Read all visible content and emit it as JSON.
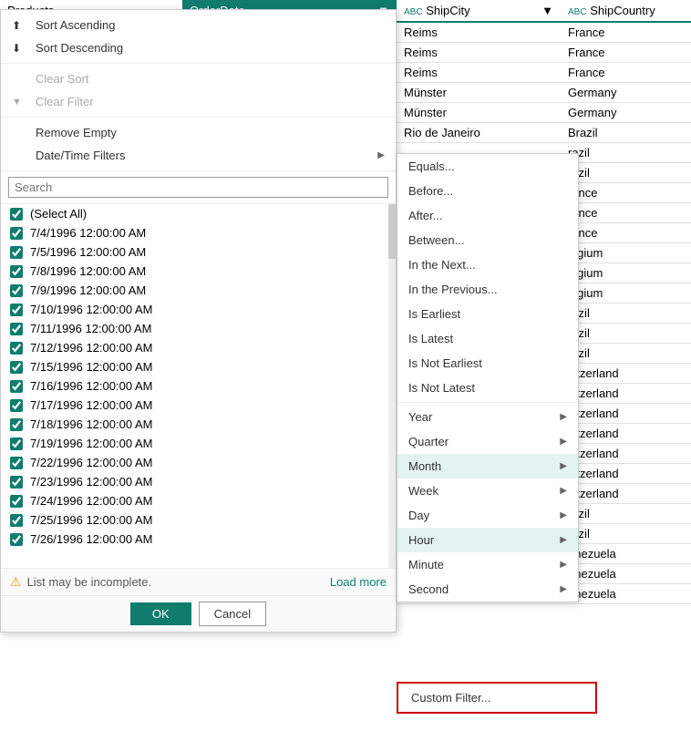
{
  "header": {
    "products_label": "Products",
    "order_date_label": "OrderDate",
    "ship_city_label": "ShipCity",
    "ship_country_label": "ShipCountry"
  },
  "table_rows": [
    {
      "city": "Reims",
      "country": "France"
    },
    {
      "city": "Reims",
      "country": "France"
    },
    {
      "city": "Reims",
      "country": "France"
    },
    {
      "city": "Münster",
      "country": "Germany"
    },
    {
      "city": "Münster",
      "country": "Germany"
    },
    {
      "city": "Rio de Janeiro",
      "country": "Brazil"
    },
    {
      "city": "",
      "country": "razil"
    },
    {
      "city": "",
      "country": "razil"
    },
    {
      "city": "",
      "country": "rance"
    },
    {
      "city": "",
      "country": "rance"
    },
    {
      "city": "",
      "country": "rance"
    },
    {
      "city": "",
      "country": "elgium"
    },
    {
      "city": "",
      "country": "elgium"
    },
    {
      "city": "",
      "country": "elgium"
    },
    {
      "city": "",
      "country": "razil"
    },
    {
      "city": "",
      "country": "razil"
    },
    {
      "city": "",
      "country": "razil"
    },
    {
      "city": "",
      "country": "vitzerland"
    },
    {
      "city": "",
      "country": "vitzerland"
    },
    {
      "city": "",
      "country": "vitzerland"
    },
    {
      "city": "",
      "country": "vitzerland"
    },
    {
      "city": "",
      "country": "vitzerland"
    },
    {
      "city": "",
      "country": "vitzerland"
    },
    {
      "city": "",
      "country": "vitzerland"
    },
    {
      "city": "",
      "country": "razil"
    },
    {
      "city": "",
      "country": "razil"
    },
    {
      "city": "",
      "country": "enezuela"
    },
    {
      "city": "",
      "country": "enezuela"
    },
    {
      "city": "",
      "country": "enezuela"
    }
  ],
  "menu": {
    "sort_ascending": "Sort Ascending",
    "sort_descending": "Sort Descending",
    "clear_sort": "Clear Sort",
    "clear_filter": "Clear Filter",
    "remove_empty": "Remove Empty",
    "datetime_filters": "Date/Time Filters",
    "search_placeholder": "Search",
    "select_all": "(Select All)"
  },
  "checkboxes": [
    "7/4/1996 12:00:00 AM",
    "7/5/1996 12:00:00 AM",
    "7/8/1996 12:00:00 AM",
    "7/9/1996 12:00:00 AM",
    "7/10/1996 12:00:00 AM",
    "7/11/1996 12:00:00 AM",
    "7/12/1996 12:00:00 AM",
    "7/15/1996 12:00:00 AM",
    "7/16/1996 12:00:00 AM",
    "7/17/1996 12:00:00 AM",
    "7/18/1996 12:00:00 AM",
    "7/19/1996 12:00:00 AM",
    "7/22/1996 12:00:00 AM",
    "7/23/1996 12:00:00 AM",
    "7/24/1996 12:00:00 AM",
    "7/25/1996 12:00:00 AM",
    "7/26/1996 12:00:00 AM"
  ],
  "footer": {
    "warning_text": "List may be incomplete.",
    "load_more": "Load more"
  },
  "buttons": {
    "ok": "OK",
    "cancel": "Cancel"
  },
  "submenu": {
    "items": [
      {
        "label": "Equals...",
        "has_arrow": false
      },
      {
        "label": "Before...",
        "has_arrow": false
      },
      {
        "label": "After...",
        "has_arrow": false
      },
      {
        "label": "Between...",
        "has_arrow": false
      },
      {
        "label": "In the Next...",
        "has_arrow": false
      },
      {
        "label": "In the Previous...",
        "has_arrow": false
      },
      {
        "label": "Is Earliest",
        "has_arrow": false
      },
      {
        "label": "Is Latest",
        "has_arrow": false
      },
      {
        "label": "Is Not Earliest",
        "has_arrow": false
      },
      {
        "label": "Is Not Latest",
        "has_arrow": false
      },
      {
        "label": "Year",
        "has_arrow": true
      },
      {
        "label": "Quarter",
        "has_arrow": true
      },
      {
        "label": "Month",
        "has_arrow": true
      },
      {
        "label": "Week",
        "has_arrow": true
      },
      {
        "label": "Day",
        "has_arrow": true
      },
      {
        "label": "Hour",
        "has_arrow": true
      },
      {
        "label": "Minute",
        "has_arrow": true
      },
      {
        "label": "Second",
        "has_arrow": true
      }
    ]
  },
  "custom_filter": {
    "label": "Custom Filter..."
  },
  "icons": {
    "sort_asc": "⬆",
    "sort_desc": "⬇",
    "filter": "▼",
    "warning": "⚠"
  }
}
